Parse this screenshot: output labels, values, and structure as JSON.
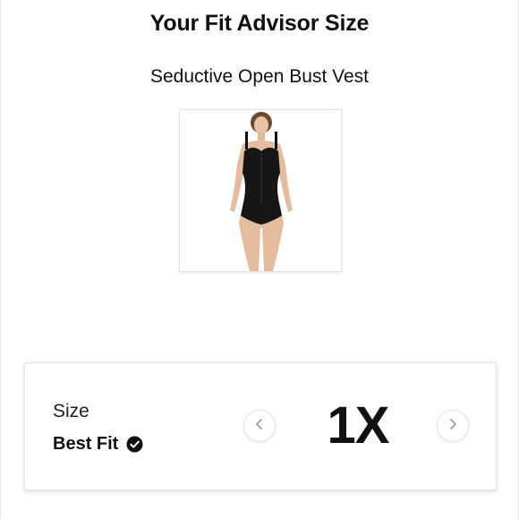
{
  "header": {
    "title": "Your Fit Advisor Size"
  },
  "product": {
    "name": "Seductive Open Bust Vest",
    "image_icon": "product-photo"
  },
  "size_card": {
    "label": "Size",
    "best_fit_label": "Best Fit",
    "best_fit_icon": "check-circle-icon",
    "value": "1X",
    "prev_icon": "chevron-left-icon",
    "next_icon": "chevron-right-icon"
  },
  "colors": {
    "text": "#111111",
    "border": "#e2e2e2",
    "chevron": "#999999"
  }
}
